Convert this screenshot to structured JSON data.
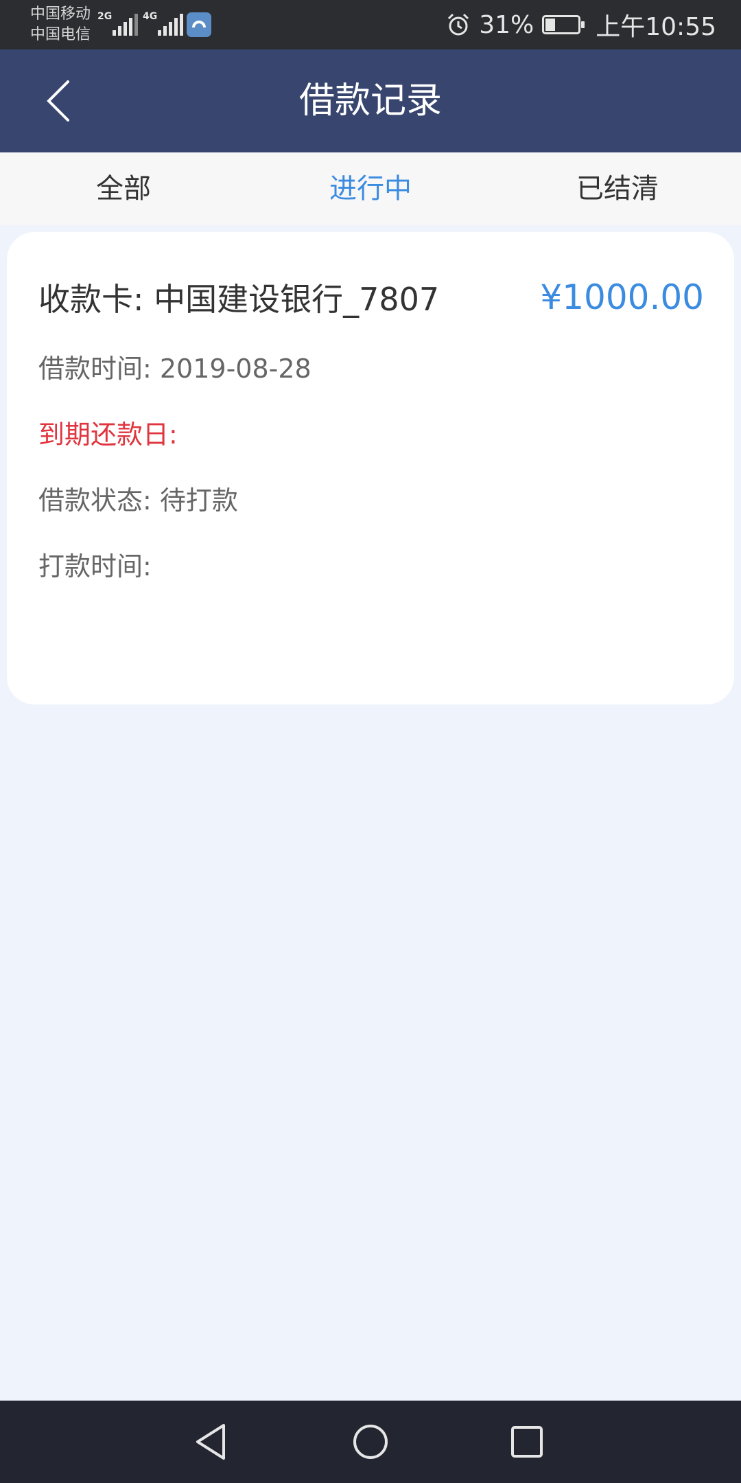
{
  "status_bar": {
    "carrier_1": "中国移动",
    "carrier_2": "中国电信",
    "network_1": "2G",
    "network_2": "4G",
    "battery_percent": "31%",
    "battery_level": 0.31,
    "time": "上午10:55"
  },
  "header": {
    "title": "借款记录"
  },
  "tabs": [
    {
      "label": "全部",
      "active": false
    },
    {
      "label": "进行中",
      "active": true
    },
    {
      "label": "已结清",
      "active": false
    }
  ],
  "loan_card": {
    "card_label": "收款卡: 中国建设银行_7807",
    "amount": "¥1000.00",
    "loan_time": "借款时间: 2019-08-28",
    "due_date": "到期还款日:",
    "status": "借款状态: 待打款",
    "payment_time": "打款时间:"
  },
  "colors": {
    "app_bar": "#38466f",
    "accent": "#3b8be0",
    "due_red": "#e0353f",
    "background": "#eff3fb"
  },
  "icons": {
    "back": "back-arrow-icon",
    "alarm": "alarm-icon",
    "nav_back": "nav-back-icon",
    "nav_home": "nav-home-icon",
    "nav_recents": "nav-recents-icon"
  }
}
